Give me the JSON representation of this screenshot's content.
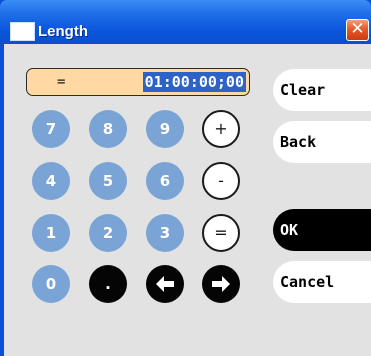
{
  "window": {
    "title": "Length",
    "close_glyph": "✕",
    "icon": "window-icon"
  },
  "display": {
    "operator": "=",
    "value": "01:00:00;00"
  },
  "keypad": {
    "k7": "7",
    "k8": "8",
    "k9": "9",
    "plus": "+",
    "k4": "4",
    "k5": "5",
    "k6": "6",
    "minus": "-",
    "k1": "1",
    "k2": "2",
    "k3": "3",
    "equals": "=",
    "k0": "0",
    "dot": ".",
    "left_icon": "arrow-left-icon",
    "right_icon": "arrow-right-icon"
  },
  "side": {
    "clear": "Clear",
    "back": "Back",
    "ok": "OK",
    "cancel": "Cancel"
  },
  "colors": {
    "titlebar": "#0a55dc",
    "display_bg": "#ffd8a3",
    "selection": "#2d63c9",
    "digit_key": "#7aa3d6",
    "client_bg": "#e2e2e2"
  }
}
